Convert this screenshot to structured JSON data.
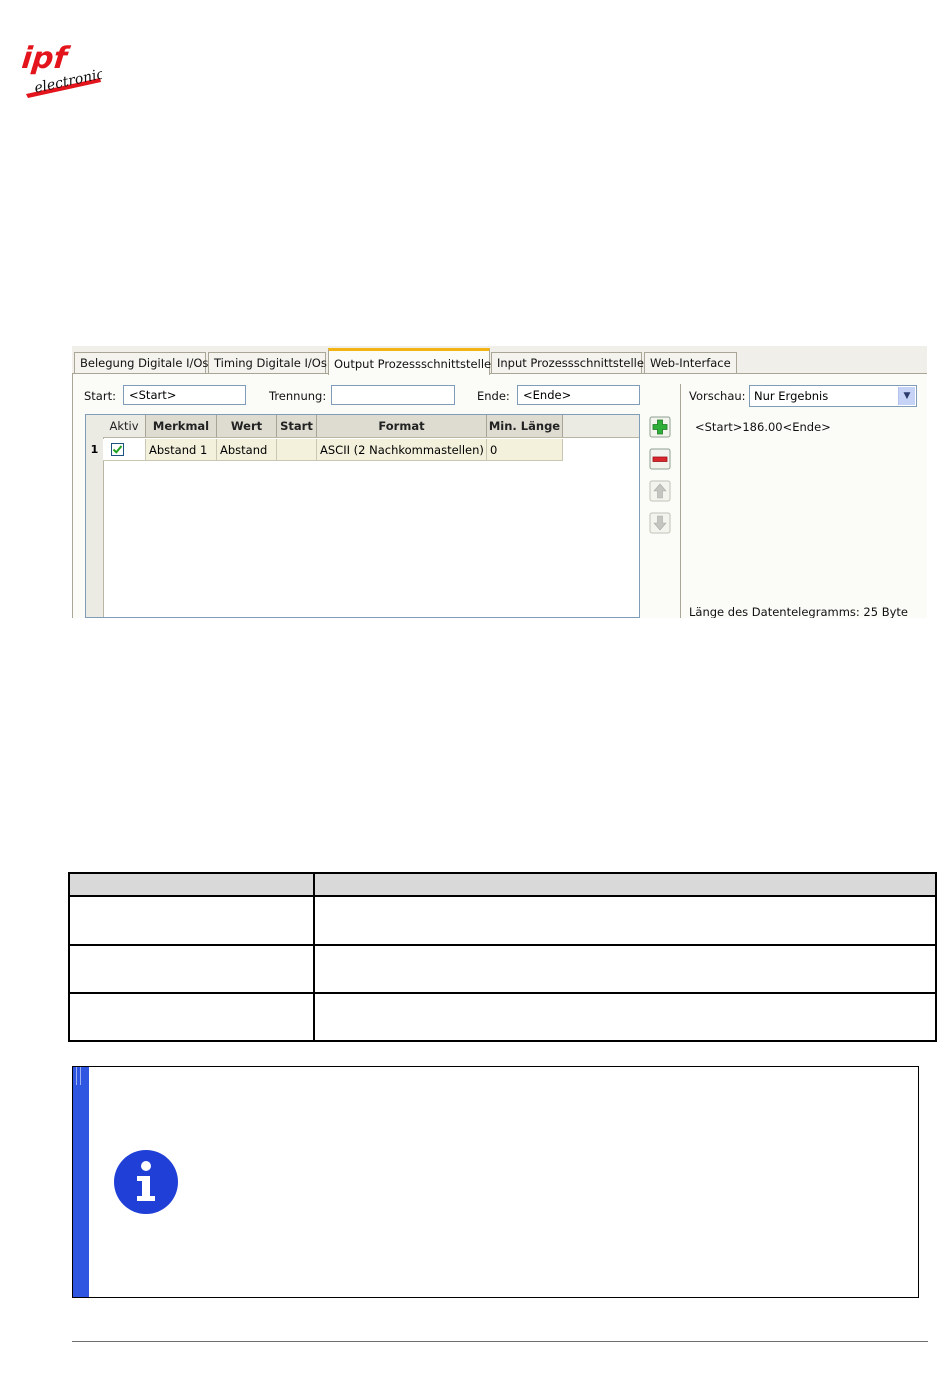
{
  "logo": {
    "line1": "ipf",
    "line2": "electronic"
  },
  "config_window": {
    "tabs": [
      "Belegung Digitale I/Os",
      "Timing Digitale I/Os",
      "Output Prozessschnittstelle",
      "Input Prozessschnittstelle",
      "Web-Interface"
    ],
    "active_tab": "Output Prozessschnittstelle",
    "start_label": "Start:",
    "start_value": "<Start>",
    "separator_label": "Trennung:",
    "separator_value": "",
    "end_label": "Ende:",
    "end_value": "<Ende>",
    "grid": {
      "headers": [
        "Aktiv",
        "Merkmal",
        "Wert",
        "Start",
        "Format",
        "Min. Länge"
      ],
      "rows": [
        {
          "num": "1",
          "aktiv": true,
          "merkmal": "Abstand 1",
          "wert": "Abstand",
          "start": "",
          "format": "ASCII (2 Nachkommastellen)",
          "min_laenge": "0"
        }
      ]
    },
    "buttons": {
      "add": "add-icon",
      "remove": "remove-icon",
      "up": "arrow-up-icon",
      "down": "arrow-down-icon"
    },
    "preview_label": "Vorschau:",
    "preview_option": "Nur Ergebnis",
    "preview_text": "<Start>186.00<Ende>",
    "telegram_length": "Länge des Datentelegramms:  25 Byte"
  },
  "colors": {
    "tab_accent": "#f2b413",
    "note_bar": "#2e56e0",
    "info_icon": "#1f3fd6"
  }
}
